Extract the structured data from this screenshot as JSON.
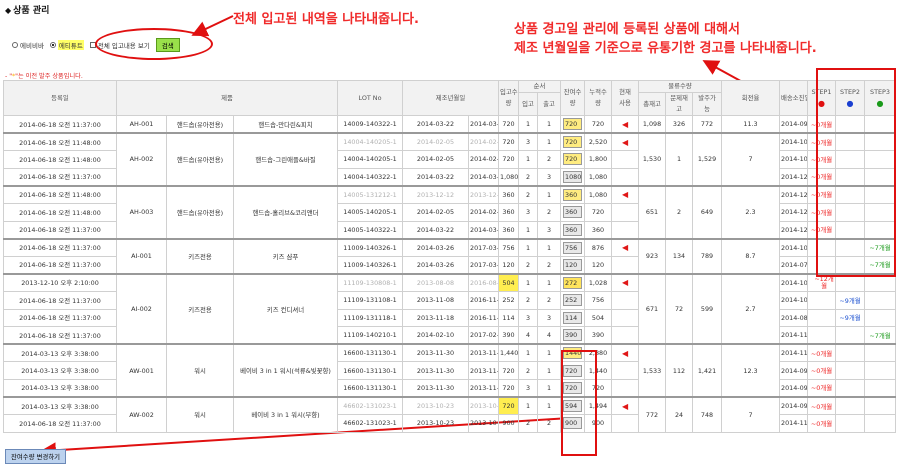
{
  "page": {
    "title": "상품 관리",
    "title_icon": "diamond-bullet"
  },
  "filters": {
    "radio1": "에비비바",
    "radio2": "에티튜트",
    "checkbox": "전체 입고내용 보기",
    "search_btn": "검색"
  },
  "note": {
    "star": "*",
    "text": "는 이전 발주 상품입니다."
  },
  "annotations": {
    "a1": "전체 입고된 내역을 나타내줍니다.",
    "a2_line1": "상품 경고일 관리에 등록된 상품에 대해서",
    "a2_line2": "제조 년월일을 기준으로 유통기한 경고를 나타내줍니다."
  },
  "headers": {
    "reg_date": "등록일",
    "product": "제품",
    "lot": "LOT No",
    "mfg": "제조년월일",
    "in_qty_1": "입고수",
    "in_qty_2": "량",
    "order": "순서",
    "order_in": "입고",
    "order_out": "출고",
    "rem_1": "잔여수",
    "rem_2": "량",
    "cum_1": "누적수",
    "cum_2": "량",
    "cur_1": "현재",
    "cur_2": "사용",
    "logi": "물류수량",
    "logi_total": "총재고",
    "logi_prob_1": "문제재",
    "logi_prob_2": "고",
    "logi_order_1": "발주가",
    "logi_order_2": "능",
    "turn": "회전율",
    "expiry": "배송소진일",
    "step1": "STEP1",
    "step2": "STEP2",
    "step3": "STEP3"
  },
  "colors": {
    "step1": "#e01010",
    "step2": "#1a3fd0",
    "step3": "#1a9a1a",
    "annotation": "#f02a2a"
  },
  "rows": [
    {
      "date": "2014-06-18 오전 11:37:00",
      "code": "AH-001",
      "brand": "핸드솝(유아전용)",
      "name": "핸드솝-만다린&피치",
      "lot": "14009-140322-1",
      "mfg1": "2014-03-22",
      "mfg2": "2014-03-22",
      "in": "720",
      "o1": "1",
      "o2": "1",
      "rem": "720",
      "cum": "720",
      "logi_total": "1,098",
      "logi_prob": "326",
      "logi_order": "772",
      "turn": "11.3",
      "exp": "2014-09-09 (63)",
      "s1": "~0개월",
      "s2": "",
      "s3": ""
    },
    {
      "date": "2014-06-18 오전 11:48:00",
      "lot": "14004-140205-1",
      "mfg1": "2014-02-05",
      "mfg2": "2014-02-05",
      "in": "720",
      "o1": "3",
      "o2": "1",
      "rem": "720",
      "cum": "2,520",
      "exp": "2014-10-18 (102)",
      "s1": "~0개월"
    },
    {
      "date": "2014-06-18 오전 11:48:00",
      "code": "AH-002",
      "brand": "핸드솝(유아전용)",
      "name": "핸드솝-그린애플&바질",
      "lot": "14004-140205-1",
      "mfg1": "2014-02-05",
      "mfg2": "2014-02-05",
      "in": "720",
      "o1": "1",
      "o2": "2",
      "rem": "720",
      "cum": "1,800",
      "logi_total": "1,530",
      "logi_prob": "1",
      "logi_order": "1,529",
      "turn": "7",
      "exp": "2014-10-18 (102)",
      "s1": "~0개월"
    },
    {
      "date": "2014-06-18 오전 11:37:00",
      "lot": "14004-140322-1",
      "mfg1": "2014-03-22",
      "mfg2": "2014-03-22",
      "in": "1,080",
      "o1": "2",
      "o2": "3",
      "rem": "1080",
      "cum": "1,080",
      "exp": "2014-12-09 (154)",
      "s1": "~0개월"
    },
    {
      "date": "2014-06-18 오전 11:48:00",
      "lot": "14005-131212-1",
      "mfg1": "2013-12-12",
      "mfg2": "2013-12-12",
      "in": "360",
      "o1": "2",
      "o2": "1",
      "rem": "360",
      "cum": "1,080",
      "exp": "2014-12-11 (156)",
      "s1": "~0개월"
    },
    {
      "date": "2014-06-18 오전 11:48:00",
      "code": "AH-003",
      "brand": "핸드솝(유아전용)",
      "name": "핸드솝-홀리브&코리앤더",
      "lot": "14005-140205-1",
      "mfg1": "2014-02-05",
      "mfg2": "2014-02-05",
      "in": "360",
      "o1": "3",
      "o2": "2",
      "rem": "360",
      "cum": "720",
      "logi_total": "651",
      "logi_prob": "2",
      "logi_order": "649",
      "turn": "2.3",
      "exp": "2014-12-11 (156)",
      "s1": "~0개월"
    },
    {
      "date": "2014-06-18 오전 11:37:00",
      "lot": "14005-140322-1",
      "mfg1": "2014-03-22",
      "mfg2": "2014-03-22",
      "in": "360",
      "o1": "1",
      "o2": "3",
      "rem": "360",
      "cum": "360",
      "exp": "2014-12-11 (156)",
      "s1": "~0개월"
    },
    {
      "date": "2014-06-18 오전 11:37:00",
      "lot": "11009-140326-1",
      "mfg1": "2014-03-26",
      "mfg2": "2017-03-26",
      "in": "756",
      "o1": "1",
      "o2": "1",
      "rem": "756",
      "cum": "876",
      "exp": "2014-10-02 (86)",
      "s3": "~7개월"
    },
    {
      "date": "2014-06-18 오전 11:37:00",
      "code": "AI-001",
      "brand": "키즈전용",
      "name": "키즈 샴푸",
      "lot": "11009-140326-1",
      "mfg1": "2014-03-26",
      "mfg2": "2017-03-26",
      "in": "120",
      "o1": "2",
      "o2": "2",
      "rem": "120",
      "cum": "120",
      "logi_total": "923",
      "logi_prob": "134",
      "logi_order": "789",
      "turn": "8.7",
      "exp": "2014-07-21 (13)",
      "s3": "~7개월"
    },
    {
      "date": "2013-12-10 오후 2:10:00",
      "lot": "11109-130808-1",
      "mfg1": "2013-08-08",
      "mfg2": "2016-08-08",
      "in": "504",
      "o1": "1",
      "o2": "1",
      "rem": "272",
      "cum": "1,028",
      "exp": "2014-10-16 (100)",
      "s1": "~12개",
      "s1b": "월"
    },
    {
      "date": "2014-06-18 오전 11:37:00",
      "code": "AI-002",
      "brand": "키즈전용",
      "name": "키즈 컨디셔너",
      "lot": "11109-131108-1",
      "mfg1": "2013-11-08",
      "mfg2": "2016-11-08",
      "in": "252",
      "o1": "2",
      "o2": "2",
      "rem": "252",
      "cum": "756",
      "logi_total": "671",
      "logi_prob": "72",
      "logi_order": "599",
      "turn": "2.7",
      "exp": "2014-10-09 (93)",
      "s2": "~9개월"
    },
    {
      "date": "2014-06-18 오전 11:37:00",
      "lot": "11109-131118-1",
      "mfg1": "2013-11-18",
      "mfg2": "2016-11-18",
      "in": "114",
      "o1": "3",
      "o2": "3",
      "rem": "114",
      "cum": "504",
      "exp": "2014-08-19 (42)",
      "s2": "~9개월"
    },
    {
      "date": "2014-06-18 오전 11:37:00",
      "lot": "11109-140210-1",
      "mfg1": "2014-02-10",
      "mfg2": "2017-02-10",
      "in": "390",
      "o1": "4",
      "o2": "4",
      "rem": "390",
      "cum": "390",
      "exp": "2014-11-29 (144)",
      "s3": "~7개월"
    },
    {
      "date": "2014-03-13 오후 3:38:00",
      "lot": "16600-131130-1",
      "mfg1": "2013-11-30",
      "mfg2": "2013-11-30",
      "in": "1,440",
      "o1": "1",
      "o2": "1",
      "rem": "1440",
      "cum": "2,880",
      "exp": "2014-11-02 (117)",
      "s1": "~0개월"
    },
    {
      "date": "2014-03-13 오후 3:38:00",
      "code": "AW-001",
      "brand": "워시",
      "name": "베이비 3 in 1 워시(석류&빛꽃향)",
      "lot": "16600-131130-1",
      "mfg1": "2013-11-30",
      "mfg2": "2013-11-30",
      "in": "720",
      "o1": "2",
      "o2": "1",
      "rem": "720",
      "cum": "1,440",
      "logi_total": "1,533",
      "logi_prob": "112",
      "logi_order": "1,421",
      "turn": "12.3",
      "exp": "2014-09-04 (58)",
      "s1": "~0개월"
    },
    {
      "date": "2014-03-13 오후 3:38:00",
      "lot": "16600-131130-1",
      "mfg1": "2013-11-30",
      "mfg2": "2013-11-30",
      "in": "720",
      "o1": "3",
      "o2": "1",
      "rem": "720",
      "cum": "720",
      "exp": "2014-09-04 (58)",
      "s1": "~0개월"
    },
    {
      "date": "2014-03-13 오후 3:38:00",
      "lot": "46602-131023-1",
      "mfg1": "2013-10-23",
      "mfg2": "2013-10-23",
      "in": "720",
      "o1": "1",
      "o2": "1",
      "rem": "594",
      "cum": "1,494",
      "exp": "2014-09-30 (84)",
      "s1": "~0개월"
    },
    {
      "date": "2014-06-18 오전 11:37:00",
      "code": "AW-002",
      "brand": "워시",
      "name": "베이비 3 in 1 워시(무향)",
      "lot": "46602-131023-1",
      "mfg1": "2013-10-23",
      "mfg2": "2013-10-23",
      "in": "900",
      "o1": "2",
      "o2": "2",
      "rem": "900",
      "cum": "900",
      "logi_total": "772",
      "logi_prob": "24",
      "logi_order": "748",
      "turn": "7",
      "exp": "2014-11-13 (128)",
      "s1": "~0개월"
    }
  ],
  "bottom": {
    "btn": "잔여수량 변경하기"
  }
}
